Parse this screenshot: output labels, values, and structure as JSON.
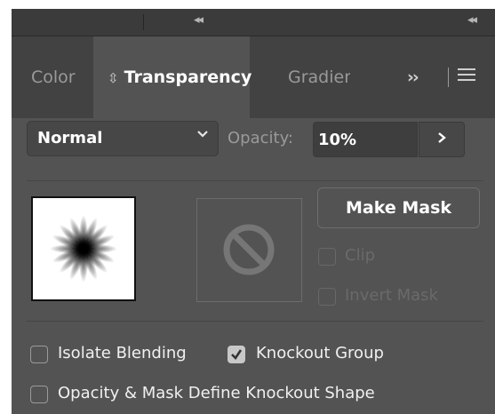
{
  "header": {
    "left_collapse_icon": "double-chevron-left",
    "right_collapse_icon": "double-chevron-left"
  },
  "tabs": {
    "color_label": "Color",
    "transparency_label": "Transparency",
    "gradient_label": "Gradien",
    "more_label": "››",
    "menu_icon": "hamburger-menu"
  },
  "blend": {
    "mode": "Normal",
    "opacity_label": "Opacity:",
    "opacity_value": "10%",
    "opacity_arrow": ">"
  },
  "mask": {
    "make_mask_label": "Make Mask",
    "clip_label": "Clip",
    "invert_mask_label": "Invert Mask",
    "clip_checked": false,
    "invert_mask_checked": false,
    "empty_mask_icon": "no-symbol"
  },
  "options": {
    "isolate_blending_label": "Isolate Blending",
    "isolate_blending_checked": false,
    "knockout_group_label": "Knockout Group",
    "knockout_group_checked": true,
    "define_knockout_label": "Opacity & Mask Define Knockout Shape",
    "define_knockout_checked": false
  },
  "colors": {
    "panel_bg": "#535353",
    "tabbar_bg": "#424242",
    "input_bg": "#3e3e3e",
    "text_active": "#ffffff",
    "text_muted": "#9a9a9a"
  }
}
